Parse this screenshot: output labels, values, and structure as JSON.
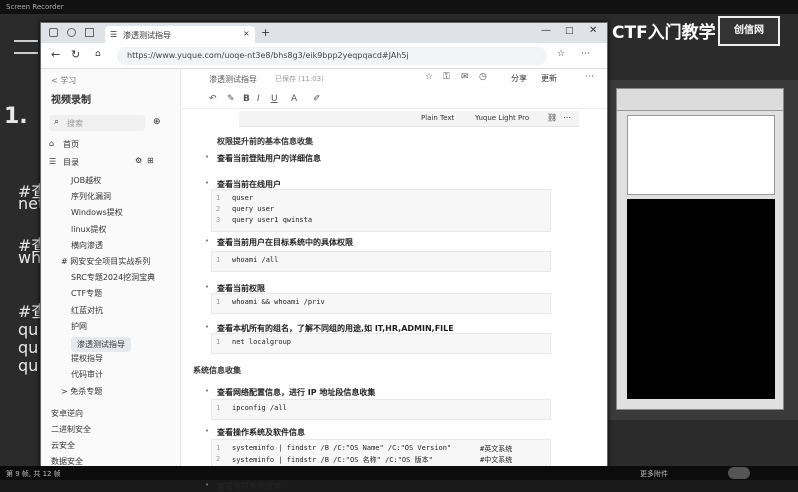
{
  "slide": {
    "topbar_text": "Screen Recorder",
    "brand": "CTF入门教学",
    "logo": "创信网",
    "heading_prefix": "1.",
    "cmd_lines": [
      "#查",
      "net",
      "#查",
      "wh",
      "#查",
      "qu",
      "qu",
      "qu"
    ]
  },
  "browser": {
    "tab_title": "渗透测试指导",
    "url": "https://www.yuque.com/uoqe-nt3e8/bhs8g3/eik9bpp2yeqpqacd#JAh5j",
    "nav_icons": [
      "back-icon",
      "refresh-icon"
    ]
  },
  "sidebar": {
    "breadcrumb": "< 学习",
    "book_title": "视频录制",
    "search_placeholder": "搜索",
    "home": "首页",
    "toc": "目录",
    "items": [
      {
        "label": "JOB越权",
        "indent": 2
      },
      {
        "label": "序列化漏洞",
        "indent": 2
      },
      {
        "label": "Windows提权",
        "indent": 2
      },
      {
        "label": "linux提权",
        "indent": 2
      },
      {
        "label": "横向渗透",
        "indent": 2
      },
      {
        "label": "# 网安安全项目实战系列",
        "indent": 1
      },
      {
        "label": "SRC专题2024挖洞宝典",
        "indent": 2
      },
      {
        "label": "CTF专题",
        "indent": 2
      },
      {
        "label": "红蓝对抗",
        "indent": 2
      },
      {
        "label": "护网",
        "indent": 2
      },
      {
        "label": "渗透测试指导",
        "indent": 2,
        "selected": true
      },
      {
        "label": "提权指导",
        "indent": 2
      },
      {
        "label": "代码审计",
        "indent": 2
      },
      {
        "label": "> 免杀专题",
        "indent": 1
      },
      {
        "label": "安卓逆向",
        "indent": 0
      },
      {
        "label": "二进制安全",
        "indent": 0
      },
      {
        "label": "云安全",
        "indent": 0
      },
      {
        "label": "数据安全",
        "indent": 0
      }
    ]
  },
  "editor": {
    "doc_title": "渗透测试指导",
    "save_status": "已保存 (11:03)",
    "share_label": "分享",
    "more_label": "更新",
    "code_lang": "Plain Text",
    "code_theme": "Yuque Light Pro",
    "blocks": [
      {
        "type": "section",
        "text": "权限提升前的基本信息收集"
      },
      {
        "type": "h4",
        "text": "查看当前登陆用户的详细信息"
      },
      {
        "type": "h4",
        "text": "查看当前在线用户"
      },
      {
        "type": "code",
        "lines": [
          "quser",
          "query user",
          "query user1 qwinsta"
        ]
      },
      {
        "type": "h4",
        "text": "查看当前用户在目标系统中的具体权限"
      },
      {
        "type": "code",
        "lines": [
          "whoami /all"
        ]
      },
      {
        "type": "h4",
        "text": "查看当前权限"
      },
      {
        "type": "code",
        "lines": [
          "whoami && whoami /priv"
        ]
      },
      {
        "type": "h4",
        "text": "查看本机所有的组名，了解不同组的用途,如 IT,HR,ADMIN,FILE"
      },
      {
        "type": "code",
        "lines": [
          "net localgroup"
        ]
      },
      {
        "type": "section",
        "text": "系统信息收集"
      },
      {
        "type": "h4",
        "text": "查看网络配置信息，进行 IP 地址段信息收集"
      },
      {
        "type": "code",
        "lines": [
          "ipconfig /all"
        ]
      },
      {
        "type": "h4",
        "text": "查看操作系统及软件信息"
      },
      {
        "type": "code2",
        "lines": [
          "systeminfo | findstr /B /C:\"OS Name\" /C:\"OS Version\"",
          "systeminfo | findstr /B /C:\"OS 名称\" /C:\"OS 版本\""
        ],
        "comments": [
          "#英文系统",
          "#中文系统"
        ]
      },
      {
        "type": "h4",
        "text": "查看当前系统版本"
      }
    ]
  },
  "taskbar": {
    "left_text": "第 9 帧, 共 12 帧",
    "right_text": "更多附件"
  }
}
